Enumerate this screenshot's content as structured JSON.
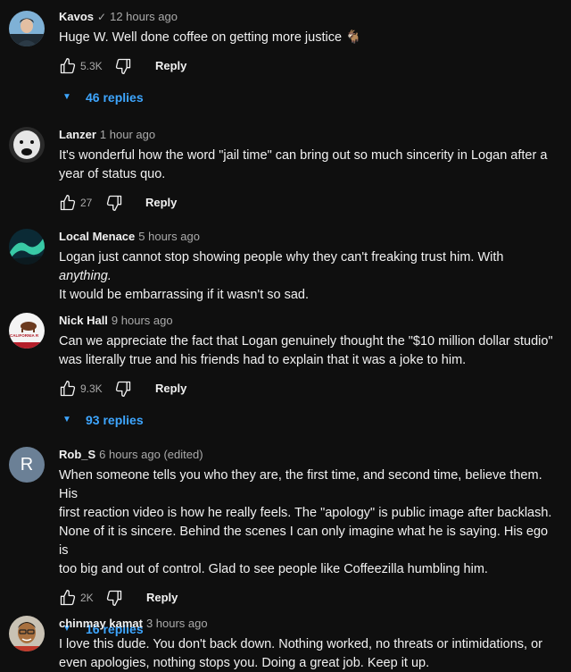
{
  "comments": [
    {
      "author": "Kavos",
      "verified_mark": "✓",
      "time": "12 hours ago",
      "lines": [
        "Huge W.  Well done coffee on getting more justice 🐐"
      ],
      "likes": "5.3K",
      "reply_label": "Reply",
      "replies": "46 replies",
      "avatar": "person-dark-avatar"
    },
    {
      "author": "Lanzer",
      "time": "1 hour ago",
      "lines": [
        "It's wonderful how the word \"jail time\" can bring out so much sincerity in Logan after a",
        "year of status quo."
      ],
      "likes": "27",
      "reply_label": "Reply",
      "avatar": "white-dog-avatar"
    },
    {
      "author": "Local Menace",
      "time": "5 hours ago",
      "line1_main": "Logan just cannot stop showing people why they can't freaking trust him. With ",
      "line1_em": "anything.",
      "line2": "It would be embarrassing if it wasn't so sad.",
      "avatar": "aurora-avatar"
    },
    {
      "author": "Nick Hall",
      "time": "9 hours ago",
      "lines": [
        "Can we appreciate the fact that Logan genuinely thought the \"$10 million dollar studio\"",
        "was literally true and his friends had to explain that it was a joke to him."
      ],
      "likes": "9.3K",
      "reply_label": "Reply",
      "replies": "93 replies",
      "avatar": "california-flag-avatar",
      "avatar_flag_text": "CALIFORNIA R"
    },
    {
      "author": "Rob_S",
      "time": "6 hours ago (edited)",
      "lines": [
        "When someone tells you who they are, the first time, and second time, believe them. His",
        "first reaction video is how he really feels. The \"apology\" is public image after backlash.",
        "None of it is sincere. Behind the scenes I can only imagine what he is saying. His ego is",
        "too big and out of control. Glad to see people like Coffeezilla humbling him."
      ],
      "likes": "2K",
      "reply_label": "Reply",
      "replies": "16 replies",
      "avatar": "letter-avatar",
      "avatar_letter": "R",
      "avatar_color": "#6b8096"
    },
    {
      "author": "chinmay kamat",
      "time": "3 hours ago",
      "lines": [
        "I love this dude. You don't back down. Nothing worked, no threats or intimidations, or",
        "even apologies, nothing stops you. Doing a great job. Keep it up."
      ],
      "avatar": "person-glasses-avatar"
    }
  ],
  "colors": {
    "background": "#0f0f0f",
    "text": "#f1f1f1",
    "secondary": "#aaaaaa",
    "link": "#3ea6ff"
  },
  "icons": {
    "like": "thumbs-up-icon",
    "dislike": "thumbs-down-icon",
    "expand": "caret-down-icon"
  }
}
